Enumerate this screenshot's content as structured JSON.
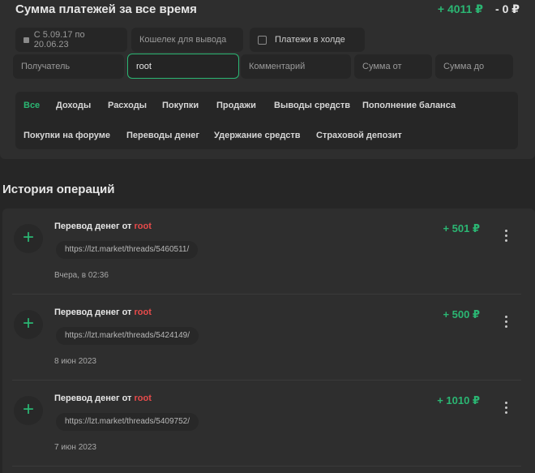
{
  "summary": {
    "title": "Сумма платежей за все время",
    "income": "+ 4011 ₽",
    "expense": "- 0 ₽"
  },
  "filters": {
    "date_range": "С 5.09.17 по 20.06.23",
    "wallet_placeholder": "Кошелек для вывода",
    "hold_label": "Платежи в холде",
    "hold_checked": false,
    "recipient_placeholder": "Получатель",
    "recipient_value": "root",
    "comment_placeholder": "Комментарий",
    "sum_from_placeholder": "Сумма от",
    "sum_to_placeholder": "Сумма до"
  },
  "categories": [
    "Все",
    "Доходы",
    "Расходы",
    "Покупки",
    "Продажи",
    "Выводы средств",
    "Пополнение баланса",
    "Покупки на форуме",
    "Переводы денег",
    "Удержание средств",
    "Страховой депозит"
  ],
  "selected_category": "Все",
  "history": {
    "title": "История операций",
    "operations": [
      {
        "title_prefix": "Перевод денег от",
        "user": "root",
        "link": "https://lzt.market/threads/5460511/",
        "date": "Вчера, в 02:36",
        "amount": "+ 501 ₽"
      },
      {
        "title_prefix": "Перевод денег от",
        "user": "root",
        "link": "https://lzt.market/threads/5424149/",
        "date": "8 июн 2023",
        "amount": "+ 500 ₽"
      },
      {
        "title_prefix": "Перевод денег от",
        "user": "root",
        "link": "https://lzt.market/threads/5409752/",
        "date": "7 июн 2023",
        "amount": "+ 1010 ₽"
      }
    ]
  },
  "icons": {
    "operation": "plus-icon",
    "menu": "more-vertical-icon",
    "date": "calendar-icon"
  },
  "colors": {
    "accent": "#2bb673",
    "user": "#e94b4b",
    "background": "#262626",
    "panel": "#2e2e2e"
  }
}
